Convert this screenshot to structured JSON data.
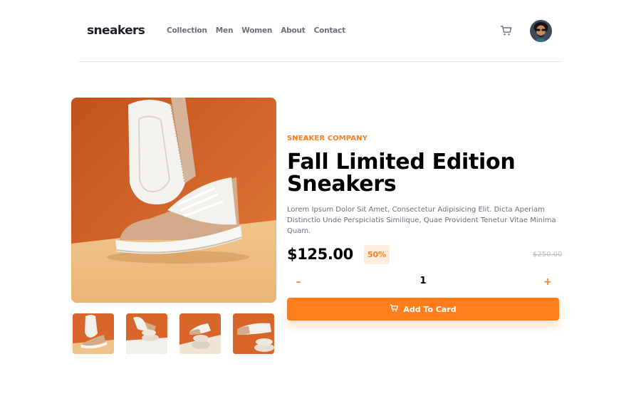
{
  "header": {
    "logo": "sneakers",
    "nav": [
      "Collection",
      "Men",
      "Women",
      "About",
      "Contact"
    ]
  },
  "product": {
    "company": "SNEAKER COMPANY",
    "title": "Fall Limited Edition Sneakers",
    "description": "Lorem Ipsum Dolor Sit Amet, Consectetur Adipisicing Elit. Dicta Aperiam Distinctio Unde Perspiciatis Similique, Quae Provident Tenetur Vitae Minima Quam.",
    "price": "$125.00",
    "discount": "50%",
    "old_price": "$250.00"
  },
  "quantity": {
    "minus": "–",
    "value": "1",
    "plus": "+"
  },
  "cta": {
    "label": "Add To Card"
  },
  "colors": {
    "accent": "#ff7e1b",
    "accent_pale": "#ffede0",
    "text_dark": "#1d2026",
    "text_muted": "#69707d"
  }
}
